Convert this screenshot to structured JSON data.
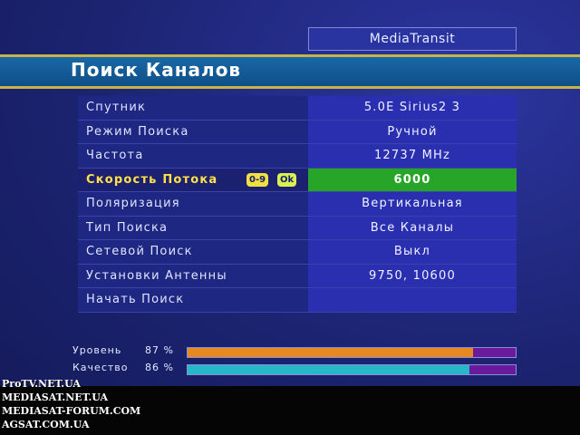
{
  "provider": "MediaTransit",
  "title": "Поиск Каналов",
  "menu": [
    {
      "label": "Спутник",
      "value": "5.0E Sirius2 3"
    },
    {
      "label": "Режим Поиска",
      "value": "Ручной"
    },
    {
      "label": "Частота",
      "value": "12737 MHz"
    },
    {
      "label": "Скорость Потока",
      "value": "6000",
      "selected": true,
      "hints": [
        "0-9",
        "Ok"
      ]
    },
    {
      "label": "Поляризация",
      "value": "Вертикальная"
    },
    {
      "label": "Тип Поиска",
      "value": "Все Каналы"
    },
    {
      "label": "Сетевой Поиск",
      "value": "Выкл"
    },
    {
      "label": "Установки Антенны",
      "value": "9750, 10600"
    },
    {
      "label": "Начать Поиск",
      "value": ""
    }
  ],
  "signal": {
    "level": {
      "label": "Уровень",
      "pct_text": "87 %",
      "value": 0.87,
      "color": "#e88820"
    },
    "quality": {
      "label": "Качество",
      "pct_text": "86 %",
      "value": 0.86,
      "color": "#26b8c8"
    }
  },
  "watermarks": [
    "ProTV.NET.UA",
    "MEDIASAT.NET.UA",
    "MEDIASAT-FORUM.COM",
    "AGSAT.COM.UA"
  ]
}
